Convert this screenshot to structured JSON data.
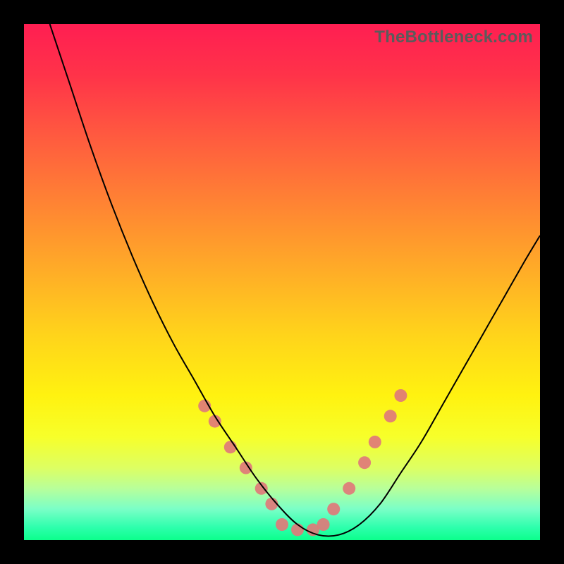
{
  "watermark": "TheBottleneck.com",
  "chart_data": {
    "type": "line",
    "title": "",
    "xlabel": "",
    "ylabel": "",
    "xlim": [
      0,
      100
    ],
    "ylim": [
      0,
      100
    ],
    "grid": false,
    "legend": false,
    "series": [
      {
        "name": "bottleneck-curve",
        "color": "#000000",
        "x": [
          5,
          9,
          13,
          17,
          21,
          25,
          29,
          33,
          37,
          41,
          45,
          49,
          53,
          57,
          61,
          65,
          69,
          73,
          77,
          81,
          85,
          89,
          93,
          97,
          100
        ],
        "y": [
          100,
          88,
          76,
          65,
          55,
          46,
          38,
          31,
          24,
          18,
          12,
          7,
          3,
          1,
          1,
          3,
          7,
          13,
          19,
          26,
          33,
          40,
          47,
          54,
          59
        ]
      },
      {
        "name": "marker-dots",
        "color": "#e07a7a",
        "type": "scatter",
        "x": [
          35,
          37,
          40,
          43,
          46,
          48,
          50,
          53,
          56,
          58,
          60,
          63,
          66,
          68,
          71,
          73
        ],
        "y": [
          26,
          23,
          18,
          14,
          10,
          7,
          3,
          2,
          2,
          3,
          6,
          10,
          15,
          19,
          24,
          28
        ]
      }
    ],
    "background_gradient_stops": [
      {
        "pos": 0.0,
        "color": "#ff1e52"
      },
      {
        "pos": 0.1,
        "color": "#ff3349"
      },
      {
        "pos": 0.22,
        "color": "#ff5b3f"
      },
      {
        "pos": 0.35,
        "color": "#ff8433"
      },
      {
        "pos": 0.48,
        "color": "#ffad27"
      },
      {
        "pos": 0.6,
        "color": "#ffd31b"
      },
      {
        "pos": 0.72,
        "color": "#fff210"
      },
      {
        "pos": 0.8,
        "color": "#f7ff2a"
      },
      {
        "pos": 0.86,
        "color": "#ddff62"
      },
      {
        "pos": 0.9,
        "color": "#b8ff9a"
      },
      {
        "pos": 0.94,
        "color": "#7affc7"
      },
      {
        "pos": 0.975,
        "color": "#2effad"
      },
      {
        "pos": 1.0,
        "color": "#0cff8c"
      }
    ]
  }
}
